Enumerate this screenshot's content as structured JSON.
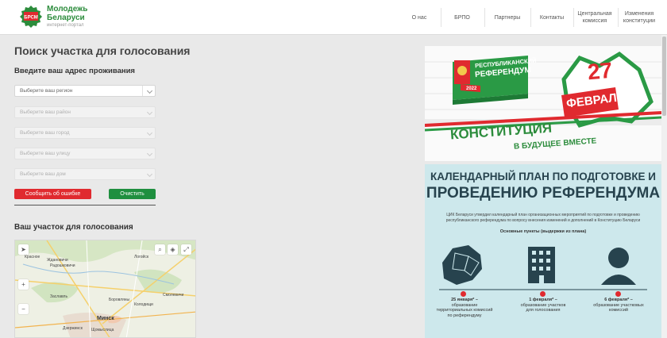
{
  "header": {
    "logo_text": "БРСМ",
    "brand_line1": "Молодежь",
    "brand_line2": "Беларуси",
    "brand_line3": "интернет-портал",
    "nav": [
      {
        "line1": "О нас",
        "line2": ""
      },
      {
        "line1": "БРПО",
        "line2": ""
      },
      {
        "line1": "Партнеры",
        "line2": ""
      },
      {
        "line1": "Контакты",
        "line2": ""
      },
      {
        "line1": "Центральная",
        "line2": "комиссия"
      },
      {
        "line1": "Изменения",
        "line2": "конституции"
      }
    ]
  },
  "search": {
    "title": "Поиск участка для голосования",
    "subtitle": "Введите ваш адрес проживания",
    "fields": {
      "region": "Выберите ваш регион",
      "district": "Выберите ваш район",
      "city": "Выберите ваш город",
      "street": "Выберите ваш улицу",
      "house": "Выберите ваш дом"
    },
    "report_button": "Сообщить об ошибке",
    "clear_button": "Очистить"
  },
  "map_section": {
    "title": "Ваш участок для голосования",
    "zoom_in": "+",
    "zoom_out": "−",
    "labels": {
      "krasnoe": "Красное",
      "zhdanovichi": "Ждановичи",
      "logoysk": "Логойск",
      "radoshkovichi": "Радошковичи",
      "zaslavl": "Заславль",
      "borovlyany": "Боровляны",
      "smolevichi": "Смолевичи",
      "dzerzhinsk": "Дзержинск",
      "kolodishchi": "Колодищи",
      "shchomyslitsa": "Щомыслица",
      "minsk": "Минск"
    }
  },
  "banner1": {
    "badge_line1": "РЕСПУБЛИКАНСКИЙ",
    "badge_line2": "РЕФЕРЕНДУМ",
    "year": "2022",
    "date_number": "27",
    "date_month": "ФЕВРАЛЯ",
    "headline1": "КОНСТИТУЦИЯ",
    "headline2": "В БУДУЩЕЕ ВМЕСТЕ"
  },
  "banner2": {
    "title_line1": "КАЛЕНДАРНЫЙ ПЛАН ПО ПОДГОТОВКЕ И",
    "title_line2": "ПРОВЕДЕНИЮ РЕФЕРЕНДУМА",
    "intro_line1": "ЦИК Беларуси утвердил календарный план организационных мероприятий по подготовке и проведению",
    "intro_line2": "республиканского референдума по вопросу внесения изменений и дополнений в Конституцию Беларуси",
    "points_title": "Основные пункты (выдержки из плана)",
    "items": [
      {
        "date": "25 января* –",
        "text1": "образование",
        "text2": "территориальных комиссий",
        "text3": "по референдуму"
      },
      {
        "date": "1 февраля* –",
        "text1": "образование участков",
        "text2": "для голосования",
        "text3": ""
      },
      {
        "date": "6 февраля* –",
        "text1": "образование участковых",
        "text2": "комиссий",
        "text3": ""
      }
    ]
  },
  "colors": {
    "brand_green": "#2c8c3c",
    "red": "#e02a2f",
    "green_button": "#1f8f3f",
    "teal_bg": "#cde8ec"
  }
}
